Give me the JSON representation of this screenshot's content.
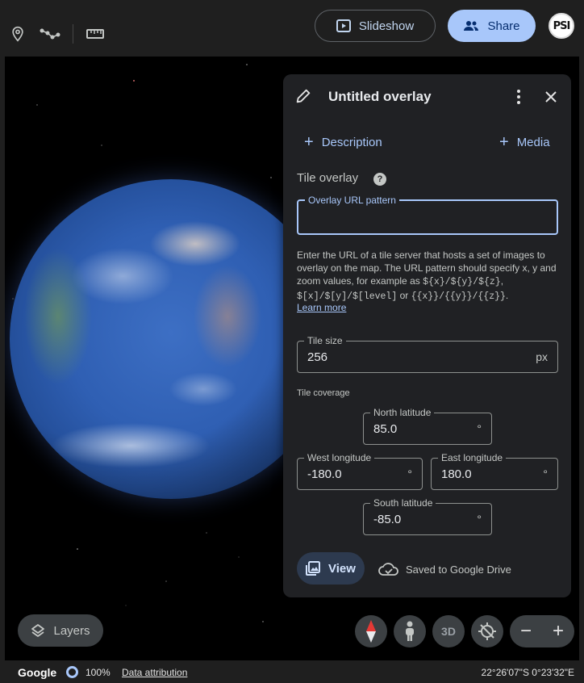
{
  "toolbar": {
    "placemark_icon": "location-pin-icon",
    "path_icon": "path-icon",
    "ruler_icon": "ruler-icon",
    "slideshow_label": "Slideshow",
    "share_label": "Share",
    "avatar_text": "PSI"
  },
  "panel": {
    "title": "Untitled overlay",
    "description_label": "Description",
    "media_label": "Media",
    "section_label": "Tile overlay",
    "url_field": {
      "label": "Overlay URL pattern",
      "value": "",
      "placeholder": ""
    },
    "help_text_1": "Enter the URL of a tile server that hosts a set of images to overlay on the map. The URL pattern should specify x, y and zoom values, for example as ",
    "help_code_1": "${x}/${y}/${z}",
    "help_text_2": ", ",
    "help_code_2": "$[x]/$[y]/$[level]",
    "help_text_3": " or ",
    "help_code_3": "{{x}}/{{y}}/{{z}}",
    "help_text_4": ".",
    "learn_more": "Learn more",
    "tile_size": {
      "label": "Tile size",
      "value": "256",
      "unit": "px"
    },
    "coverage_label": "Tile coverage",
    "north": {
      "label": "North latitude",
      "value": "85.0",
      "unit": "°"
    },
    "west": {
      "label": "West longitude",
      "value": "-180.0",
      "unit": "°"
    },
    "east": {
      "label": "East longitude",
      "value": "180.0",
      "unit": "°"
    },
    "south": {
      "label": "South latitude",
      "value": "-85.0",
      "unit": "°"
    },
    "view_label": "View",
    "saved_label": "Saved to Google Drive"
  },
  "map_controls": {
    "layers_label": "Layers",
    "label_3d": "3D",
    "zoom_out": "−",
    "zoom_in": "+"
  },
  "status": {
    "logo": "Google",
    "zoom_percent": "100%",
    "data_attribution": "Data attribution",
    "coordinates": "22°26'07\"S 0°23'32\"E"
  },
  "colors": {
    "accent": "#a8c7fa",
    "panel_bg": "#202124",
    "app_bg": "#1f1f1f"
  }
}
